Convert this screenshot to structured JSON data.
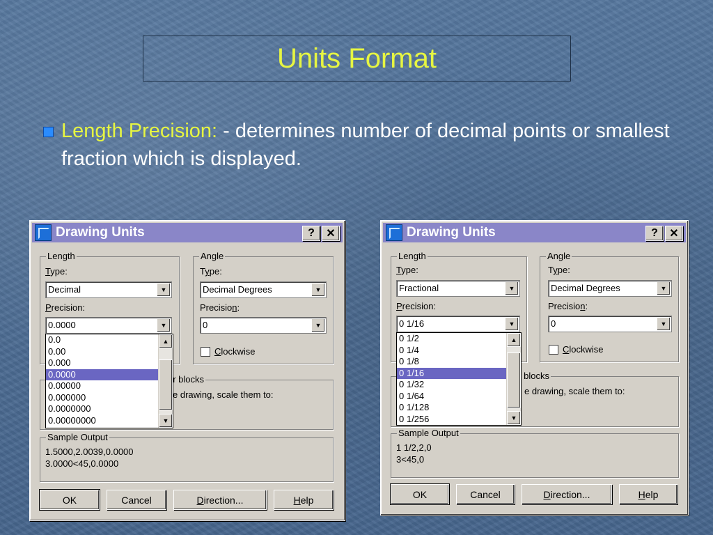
{
  "slide": {
    "title": "Units Format",
    "bullet_label": "Length Precision:",
    "bullet_text": " - determines number of decimal points or smallest fraction which is displayed."
  },
  "colors": {
    "accent": "#e6f542",
    "bullet": "#2a8cff",
    "dialog_title_bar": "#8a86c8",
    "selection": "#6a66c2"
  },
  "dialog_left": {
    "title": "Drawing Units",
    "help_btn": "?",
    "close_btn": "✕",
    "length_legend": "Length",
    "length_type_label_u": "T",
    "length_type_label_rest": "ype:",
    "length_type_value": "Decimal",
    "precision_label_u": "P",
    "precision_label_rest": "recision:",
    "precision_value": "0.0000",
    "precision_options": [
      "0.0",
      "0.00",
      "0.000",
      "0.0000",
      "0.00000",
      "0.000000",
      "0.0000000",
      "0.00000000"
    ],
    "precision_selected_index": 3,
    "angle_legend": "Angle",
    "angle_type_label_pre": "T",
    "angle_type_label_u": "y",
    "angle_type_label_rest": "pe:",
    "angle_type_value": "Decimal Degrees",
    "angle_precision_label_pre": "Precisio",
    "angle_precision_label_u": "n",
    "angle_precision_label_rest": ":",
    "angle_precision_value": "0",
    "clockwise_u": "C",
    "clockwise_rest": "lockwise",
    "blocks_legend_partial": "er blocks",
    "blocks_text_partial": "e drawing, scale them to:",
    "sample_legend": "Sample Output",
    "sample_line1": "1.5000,2.0039,0.0000",
    "sample_line2": "3.0000<45,0.0000",
    "ok": "OK",
    "cancel": "Cancel",
    "direction_u": "D",
    "direction_rest": "irection...",
    "help_u": "H",
    "help_rest": "elp"
  },
  "dialog_right": {
    "title": "Drawing Units",
    "help_btn": "?",
    "close_btn": "✕",
    "length_legend": "Length",
    "length_type_label_u": "T",
    "length_type_label_rest": "ype:",
    "length_type_value": "Fractional",
    "precision_label_u": "P",
    "precision_label_rest": "recision:",
    "precision_value": "0 1/16",
    "precision_options": [
      "0 1/2",
      "0 1/4",
      "0 1/8",
      "0 1/16",
      "0 1/32",
      "0 1/64",
      "0 1/128",
      "0 1/256"
    ],
    "precision_selected_index": 3,
    "angle_legend": "Angle",
    "angle_type_label_pre": "T",
    "angle_type_label_u": "y",
    "angle_type_label_rest": "pe:",
    "angle_type_value": "Decimal Degrees",
    "angle_precision_label_pre": "Precisio",
    "angle_precision_label_u": "n",
    "angle_precision_label_rest": ":",
    "angle_precision_value": "0",
    "clockwise_u": "C",
    "clockwise_rest": "lockwise",
    "blocks_legend_partial": "er blocks",
    "blocks_text_partial": "e drawing, scale them to:",
    "sample_legend": "Sample Output",
    "sample_line1": "1 1/2,2,0",
    "sample_line2": "3<45,0",
    "ok": "OK",
    "cancel": "Cancel",
    "direction_u": "D",
    "direction_rest": "irection...",
    "help_u": "H",
    "help_rest": "elp"
  }
}
